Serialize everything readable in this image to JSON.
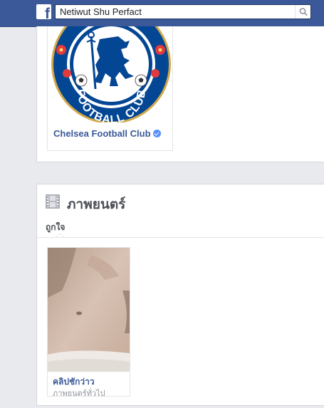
{
  "header": {
    "logo_letter": "f",
    "search_value": "Netiwut Shu Perfact"
  },
  "liked_page": {
    "name": "Chelsea Football Club",
    "logo_text": "FOOTBALL CLUB",
    "verified": true
  },
  "movies": {
    "title": "ภาพยนตร์",
    "tab_label": "ถูกใจ",
    "items": [
      {
        "title": "คลิปชักว่าว",
        "category": "ภาพยนตร์ทั่วไป"
      }
    ]
  },
  "colors": {
    "brand": "#3b5998",
    "background": "#e9eaed",
    "chelsea_blue": "#034694",
    "chelsea_gold": "#d1a94a"
  }
}
